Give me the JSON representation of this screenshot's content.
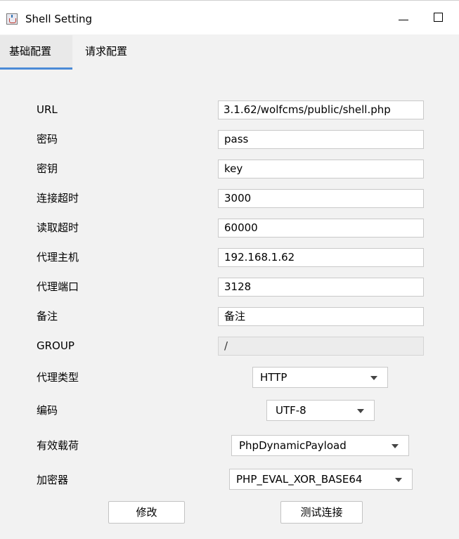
{
  "window": {
    "title": "Shell Setting"
  },
  "tabs": [
    {
      "label": "基础配置",
      "active": true
    },
    {
      "label": "请求配置",
      "active": false
    }
  ],
  "fields": {
    "url": {
      "label": "URL",
      "value": "3.1.62/wolfcms/public/shell.php"
    },
    "password": {
      "label": "密码",
      "value": "pass"
    },
    "secret_key": {
      "label": "密钥",
      "value": "key"
    },
    "connect_timeout": {
      "label": "连接超时",
      "value": "3000"
    },
    "read_timeout": {
      "label": "读取超时",
      "value": "60000"
    },
    "proxy_host": {
      "label": "代理主机",
      "value": "192.168.1.62"
    },
    "proxy_port": {
      "label": "代理端口",
      "value": "3128"
    },
    "remark": {
      "label": "备注",
      "value": "备注"
    },
    "group": {
      "label": "GROUP",
      "value": "/"
    }
  },
  "selects": {
    "proxy_type": {
      "label": "代理类型",
      "value": "HTTP"
    },
    "encoding": {
      "label": "编码",
      "value": "UTF-8"
    },
    "payload": {
      "label": "有效载荷",
      "value": "PhpDynamicPayload"
    },
    "cryption": {
      "label": "加密器",
      "value": "PHP_EVAL_XOR_BASE64"
    }
  },
  "buttons": {
    "modify": "修改",
    "test_connection": "测试连接"
  },
  "colors": {
    "tab_accent": "#4a8ad6",
    "window_bg": "#f2f2f2",
    "field_bg": "#ffffff"
  }
}
